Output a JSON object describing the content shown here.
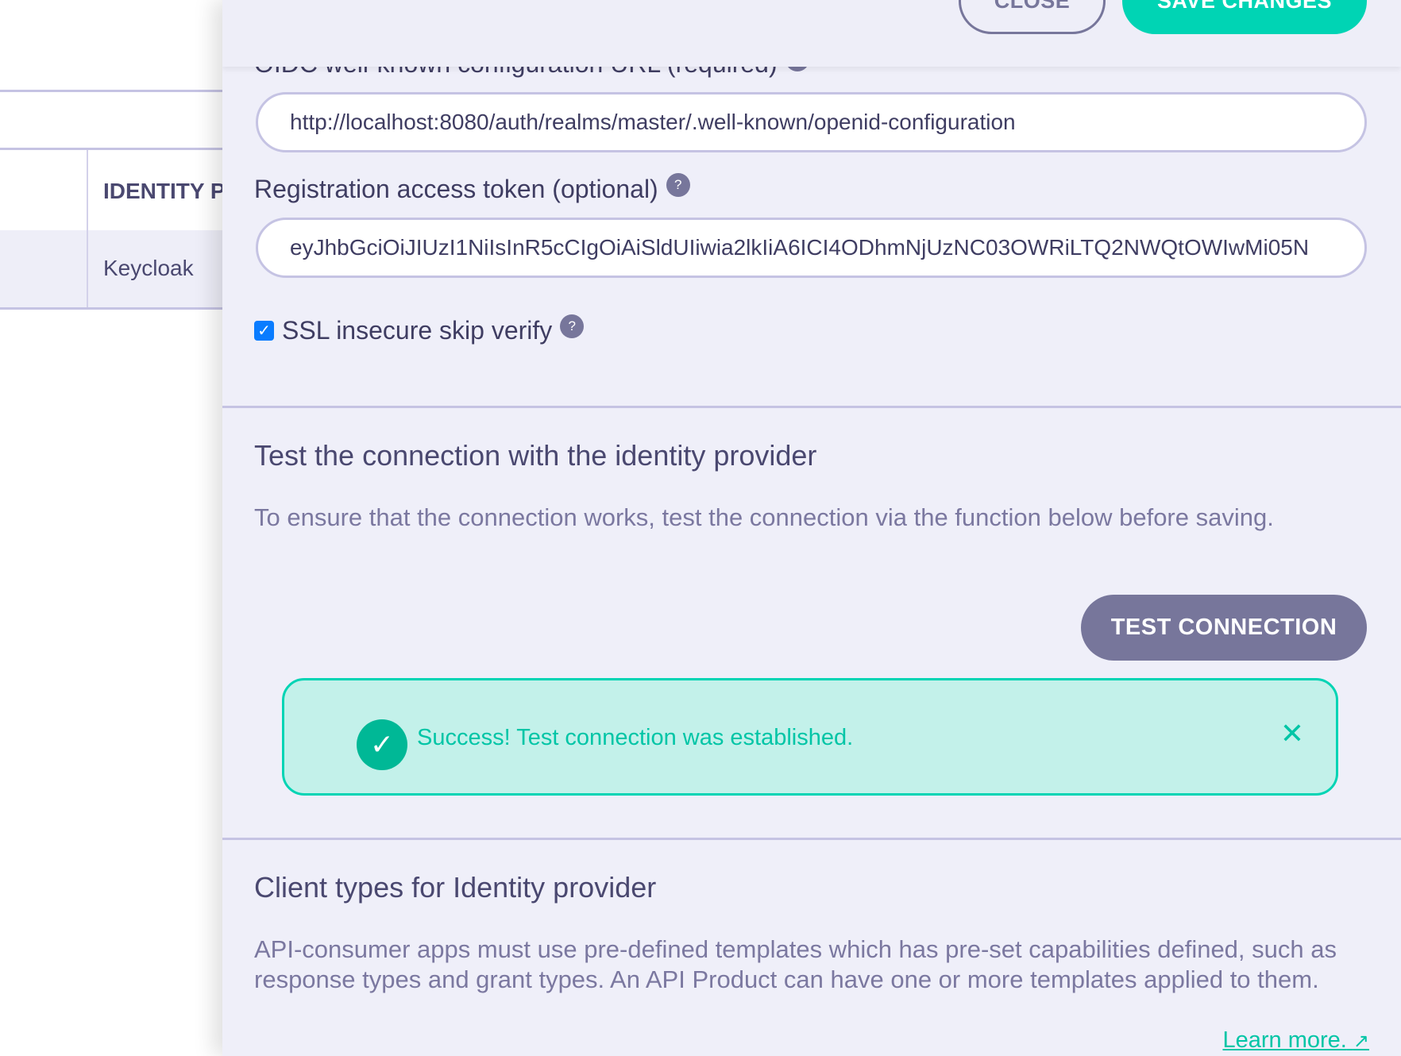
{
  "background_table": {
    "header": "IDENTITY P",
    "row": "Keycloak"
  },
  "header": {
    "close_label": "CLOSE",
    "save_label": "SAVE CHANGES"
  },
  "form": {
    "oidc_label": "OIDC well-known configuration URL (required)",
    "oidc_value": "http://localhost:8080/auth/realms/master/.well-known/openid-configuration",
    "token_label": "Registration access token (optional)",
    "token_value": "eyJhbGciOiJIUzI1NiIsInR5cCIgOiAiSldUIiwia2lkIiA6ICI4ODhmNjUzNC03OWRiLTQ2NWQtOWIwMi05N",
    "ssl_label": "SSL insecure skip verify",
    "ssl_checked": true,
    "help_glyph": "?"
  },
  "test_section": {
    "title": "Test the connection with the identity provider",
    "description": "To ensure that the connection works, test the connection via the function below before saving.",
    "button_label": "TEST CONNECTION",
    "alert_message": "Success! Test connection was established.",
    "alert_close": "✕"
  },
  "client_types": {
    "title": "Client types for Identity provider",
    "description": "API-consumer apps must use pre-defined templates which has pre-set capabilities defined, such as response types and grant types. An API Product can have one or more templates applied to them.",
    "learn_more": "Learn more."
  },
  "colors": {
    "accent": "#00d4b4",
    "secondary": "#77769b",
    "panel": "#efeff9",
    "checkbox": "#0a7cff"
  }
}
